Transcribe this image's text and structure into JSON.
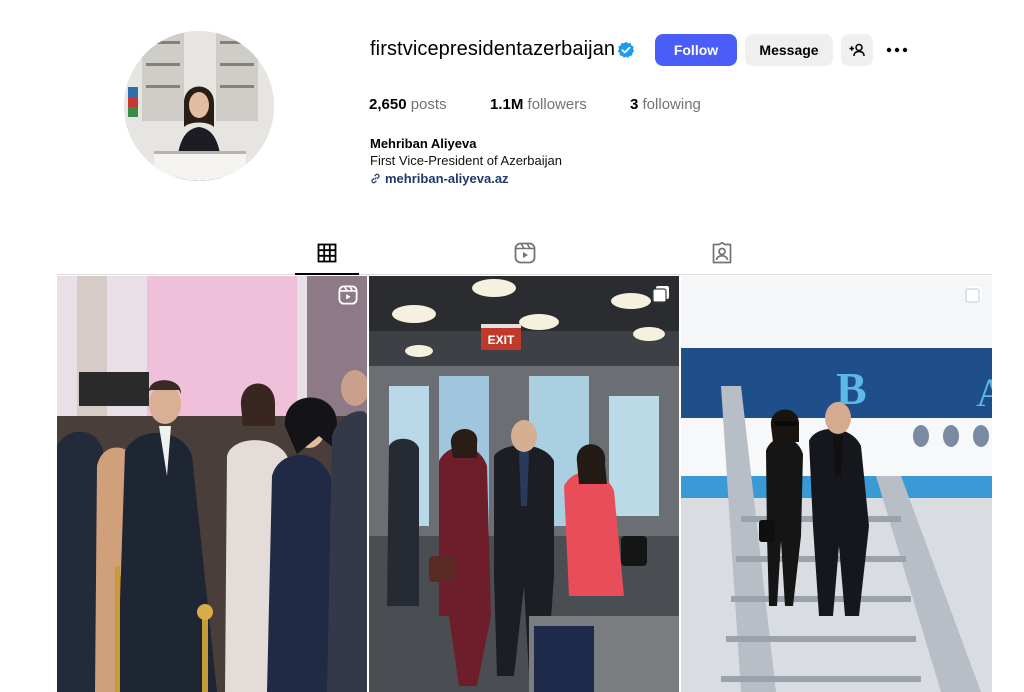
{
  "profile": {
    "username": "firstvicepresidentazerbaijan",
    "verified": true,
    "full_name": "Mehriban Aliyeva",
    "bio": "First Vice-President of Azerbaijan",
    "link": "mehriban-aliyeva.az"
  },
  "actions": {
    "follow_label": "Follow",
    "message_label": "Message",
    "suggest_icon": "add-person-icon",
    "more_icon": "more-horizontal-icon"
  },
  "stats": {
    "posts_count": "2,650",
    "posts_label": "posts",
    "followers_count": "1.1M",
    "followers_label": "followers",
    "following_count": "3",
    "following_label": "following"
  },
  "tabs": [
    {
      "icon": "grid-icon",
      "active": true
    },
    {
      "icon": "reels-icon",
      "active": false
    },
    {
      "icon": "tagged-icon",
      "active": false
    }
  ],
  "posts": [
    {
      "type": "reel",
      "badge_icon": "reels-icon"
    },
    {
      "type": "carousel",
      "badge_icon": "carousel-icon"
    },
    {
      "type": "carousel",
      "badge_icon": "carousel-icon"
    }
  ],
  "colors": {
    "accent": "#4a5df9",
    "verified": "#1d9bf0",
    "secondary_button": "#efefef",
    "muted_text": "#737373",
    "link": "#1e3a6d"
  }
}
